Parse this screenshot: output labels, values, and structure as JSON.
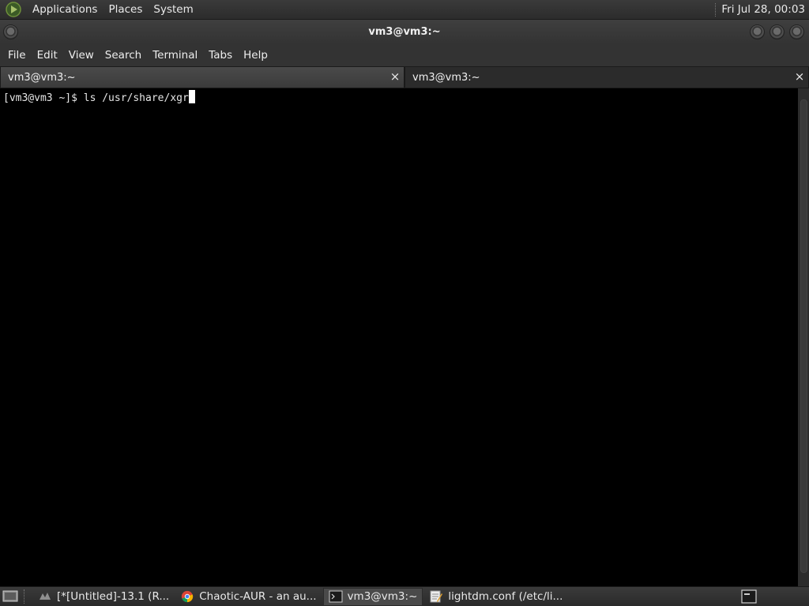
{
  "top_panel": {
    "menus": [
      "Applications",
      "Places",
      "System"
    ],
    "clock": "Fri Jul 28, 00:03"
  },
  "window": {
    "title": "vm3@vm3:~"
  },
  "menubar": {
    "items": [
      "File",
      "Edit",
      "View",
      "Search",
      "Terminal",
      "Tabs",
      "Help"
    ]
  },
  "tabs": [
    {
      "label": "vm3@vm3:~",
      "close": "×"
    },
    {
      "label": "vm3@vm3:~",
      "close": "×"
    }
  ],
  "terminal": {
    "prompt_line": "[vm3@vm3 ~]$ ls /usr/share/xgr"
  },
  "taskbar": {
    "tasks": [
      {
        "label": "[*[Untitled]-13.1 (R...",
        "icon": "image-editor-icon"
      },
      {
        "label": "Chaotic-AUR - an au...",
        "icon": "chrome-icon"
      },
      {
        "label": "vm3@vm3:~",
        "icon": "terminal-icon"
      },
      {
        "label": "lightdm.conf (/etc/li...",
        "icon": "text-editor-icon"
      }
    ]
  },
  "colors": {
    "terminal_bg": "#000000",
    "terminal_fg": "#e5e5e5",
    "panel_bg": "#333333"
  }
}
